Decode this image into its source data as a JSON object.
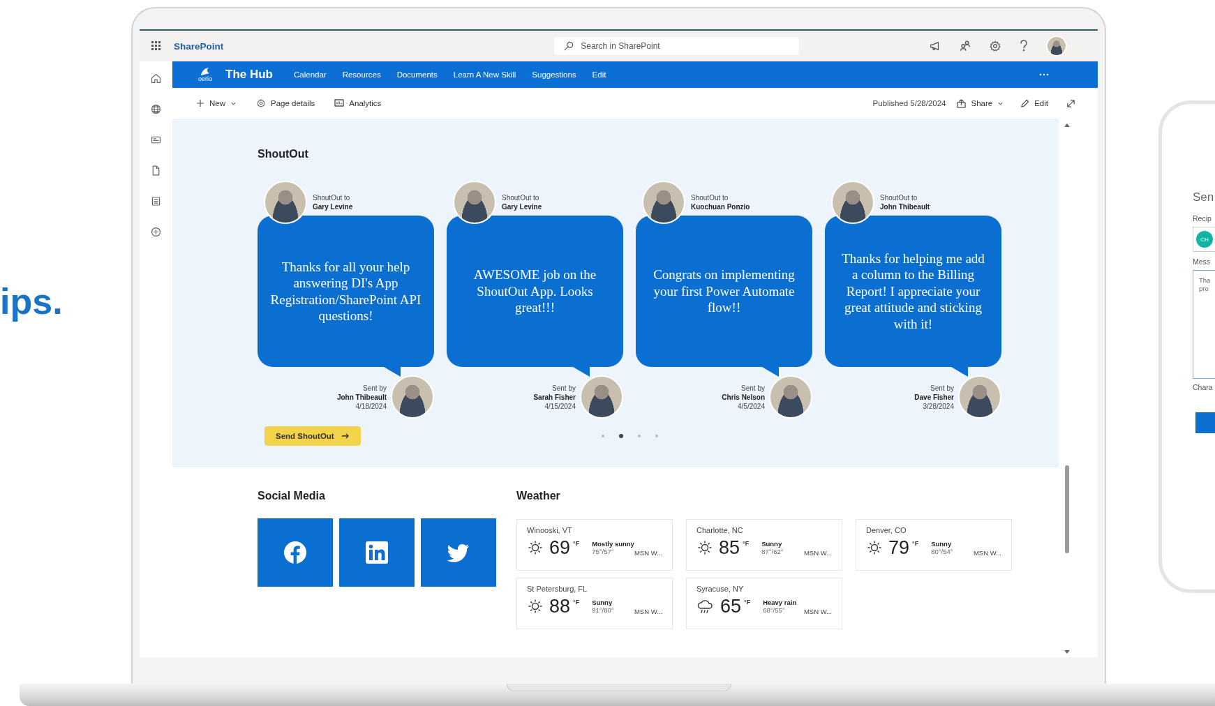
{
  "promo_text": "ips.",
  "suite_bar": {
    "app_name": "SharePoint",
    "search": {
      "placeholder": "Search in SharePoint"
    }
  },
  "site_nav": {
    "logo_text": "oerio",
    "site_title": "The Hub",
    "links": [
      "Calendar",
      "Resources",
      "Documents",
      "Learn A New Skill",
      "Suggestions",
      "Edit"
    ]
  },
  "command_bar": {
    "left": [
      {
        "label": "New",
        "kind": "menu"
      },
      {
        "label": "Page details",
        "kind": "button"
      },
      {
        "label": "Analytics",
        "kind": "button"
      }
    ],
    "published": "Published 5/28/2024",
    "right": [
      {
        "label": "Share",
        "kind": "menu"
      },
      {
        "label": "Edit",
        "kind": "button"
      }
    ]
  },
  "shoutout": {
    "title": "ShoutOut",
    "cards": [
      {
        "to_label": "ShoutOut to",
        "to_name": "Gary Levine",
        "message": "Thanks for all your help answering DI's App Registration/SharePoint API questions!",
        "sent_label": "Sent by",
        "from_name": "John Thibeault",
        "date": "4/18/2024"
      },
      {
        "to_label": "ShoutOut to",
        "to_name": "Gary Levine",
        "message": "AWESOME job on the ShoutOut App. Looks great!!!",
        "sent_label": "Sent by",
        "from_name": "Sarah Fisher",
        "date": "4/15/2024"
      },
      {
        "to_label": "ShoutOut to",
        "to_name": "Kuochuan Ponzio",
        "message": "Congrats on implementing your first Power Automate flow!!",
        "sent_label": "Sent by",
        "from_name": "Chris Nelson",
        "date": "4/5/2024"
      },
      {
        "to_label": "ShoutOut to",
        "to_name": "John Thibeault",
        "message": "Thanks for helping me add a column to the Billing Report! I appreciate your great attitude and sticking with it!",
        "sent_label": "Sent by",
        "from_name": "Dave Fisher",
        "date": "3/28/2024"
      }
    ],
    "send_button": "Send ShoutOut",
    "pager": [
      {
        "selected": false
      },
      {
        "selected": true
      },
      {
        "selected": false
      },
      {
        "selected": false
      }
    ]
  },
  "social_media": {
    "title": "Social Media"
  },
  "weather": {
    "title": "Weather",
    "cards": [
      {
        "city": "Winooski, VT",
        "kind": "sun",
        "temp": "69",
        "unit": "°F",
        "summary": "Mostly sunny",
        "range": "75°/57°",
        "source": "MSN W..."
      },
      {
        "city": "Charlotte, NC",
        "kind": "sun",
        "temp": "85",
        "unit": "°F",
        "summary": "Sunny",
        "range": "87°/62°",
        "source": "MSN W..."
      },
      {
        "city": "Denver, CO",
        "kind": "sun",
        "temp": "79",
        "unit": "°F",
        "summary": "Sunny",
        "range": "80°/54°",
        "source": "MSN W..."
      },
      {
        "city": "St Petersburg, FL",
        "kind": "sun",
        "temp": "88",
        "unit": "°F",
        "summary": "Sunny",
        "range": "91°/80°",
        "source": "MSN W..."
      },
      {
        "city": "Syracuse, NY",
        "kind": "rain",
        "temp": "65",
        "unit": "°F",
        "summary": "Heavy rain",
        "range": "68°/55°",
        "source": "MSN W..."
      }
    ]
  },
  "phone": {
    "title": "Sen",
    "recipients_label": "Recip",
    "recipient_initials": "CH",
    "message_label": "Mess",
    "message_lines": [
      "Tha",
      "pro"
    ],
    "count_label": "Chara"
  }
}
